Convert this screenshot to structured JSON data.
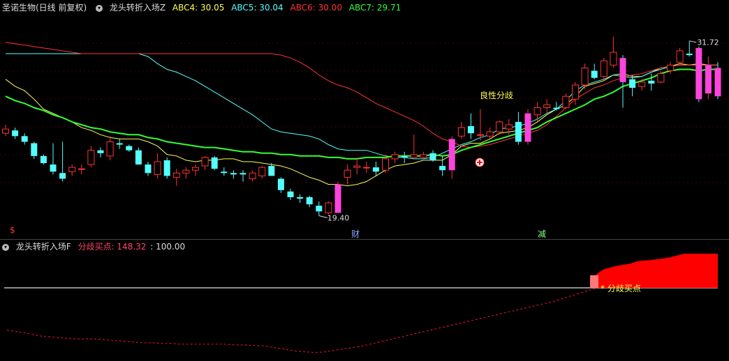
{
  "header": {
    "stock": "圣诺生物(日线 前复权)",
    "indicator": "龙头转折入场Z",
    "abc4": "ABC4: 30.05",
    "abc5": "ABC5: 30.04",
    "abc6": "ABC6: 30.00",
    "abc7": "ABC7: 29.71",
    "colors": {
      "abc4": "#ffff55",
      "abc5": "#55ffff",
      "abc6": "#ff3333",
      "abc7": "#33ff33"
    }
  },
  "lower_header": {
    "indicator": "龙头转折入场F",
    "label": "分歧买点: 148.32",
    "value": ": 100.00"
  },
  "annotations": {
    "low_price": "19.40",
    "high_price": "31.72",
    "label_good": "良性分歧",
    "mark_cai": "财",
    "mark_jian": "减",
    "mark_dollar": "$",
    "buy_label": "分歧买点"
  },
  "chart_data": [
    {
      "type": "candlestick",
      "title": "圣诺生物(日线 前复权)",
      "ylim": [
        18,
        33.5
      ],
      "candles": [
        [
          25.2,
          25.8,
          25.0,
          25.5
        ],
        [
          25.4,
          25.6,
          24.8,
          25.0
        ],
        [
          25.0,
          25.2,
          24.4,
          24.6
        ],
        [
          24.5,
          24.6,
          23.4,
          23.6
        ],
        [
          23.6,
          23.7,
          23.0,
          23.1
        ],
        [
          23.0,
          24.5,
          22.3,
          22.5
        ],
        [
          22.4,
          24.6,
          21.8,
          22.0
        ],
        [
          22.5,
          23.0,
          22.2,
          22.8
        ],
        [
          22.7,
          23.0,
          22.3,
          22.7
        ],
        [
          23.0,
          24.3,
          22.8,
          24.0
        ],
        [
          24.0,
          24.2,
          23.5,
          23.8
        ],
        [
          23.6,
          25.0,
          23.3,
          24.6
        ],
        [
          24.5,
          24.8,
          24.1,
          24.4
        ],
        [
          24.3,
          24.4,
          23.9,
          24.0
        ],
        [
          24.0,
          24.2,
          23.0,
          23.0
        ],
        [
          23.0,
          23.2,
          22.2,
          22.4
        ],
        [
          22.3,
          23.8,
          22.0,
          23.2
        ],
        [
          23.3,
          23.5,
          22.0,
          22.2
        ],
        [
          22.1,
          22.7,
          21.5,
          22.4
        ],
        [
          22.4,
          22.8,
          22.0,
          22.6
        ],
        [
          22.6,
          23.0,
          22.2,
          22.8
        ],
        [
          22.9,
          23.6,
          22.6,
          23.5
        ],
        [
          23.5,
          23.6,
          22.6,
          22.7
        ],
        [
          22.5,
          22.8,
          22.2,
          22.4
        ],
        [
          22.4,
          22.6,
          22.0,
          22.3
        ],
        [
          22.4,
          22.6,
          21.8,
          22.3
        ],
        [
          22.0,
          22.6,
          21.8,
          22.4
        ],
        [
          22.2,
          22.9,
          22.0,
          22.8
        ],
        [
          22.9,
          23.1,
          22.2,
          22.2
        ],
        [
          22.0,
          22.1,
          21.0,
          21.2
        ],
        [
          21.1,
          21.3,
          20.5,
          20.7
        ],
        [
          20.7,
          20.9,
          20.3,
          20.6
        ],
        [
          20.7,
          20.8,
          20.0,
          20.2
        ],
        [
          20.1,
          20.4,
          19.4,
          19.7
        ],
        [
          19.6,
          20.4,
          19.5,
          20.3
        ],
        [
          19.6,
          21.8,
          19.6,
          21.6
        ],
        [
          22.1,
          23.0,
          21.6,
          22.6
        ],
        [
          22.8,
          23.5,
          22.3,
          22.9
        ],
        [
          22.8,
          23.2,
          22.4,
          22.8
        ],
        [
          22.8,
          23.2,
          22.2,
          22.5
        ],
        [
          22.6,
          23.7,
          22.4,
          23.4
        ],
        [
          23.4,
          23.9,
          23.1,
          23.7
        ],
        [
          23.6,
          23.9,
          23.1,
          23.5
        ],
        [
          23.5,
          25.1,
          23.4,
          23.7
        ],
        [
          23.5,
          23.9,
          23.4,
          23.7
        ],
        [
          23.8,
          24.0,
          23.2,
          23.3
        ],
        [
          22.9,
          23.6,
          22.2,
          22.6
        ],
        [
          22.6,
          25.0,
          22.0,
          24.8
        ],
        [
          25.0,
          26.0,
          24.8,
          25.6
        ],
        [
          25.7,
          26.6,
          24.8,
          25.2
        ],
        [
          25.1,
          26.9,
          24.7,
          25.1
        ],
        [
          25.0,
          25.6,
          24.8,
          25.3
        ],
        [
          25.3,
          26.1,
          25.1,
          26.0
        ],
        [
          25.5,
          26.2,
          25.1,
          25.8
        ],
        [
          26.0,
          26.7,
          24.4,
          24.6
        ],
        [
          24.6,
          26.9,
          24.4,
          26.6
        ],
        [
          26.5,
          27.4,
          26.0,
          27.0
        ],
        [
          27.0,
          27.6,
          26.6,
          27.2
        ],
        [
          27.0,
          27.4,
          26.8,
          26.9
        ],
        [
          27.0,
          28.0,
          26.9,
          27.8
        ],
        [
          27.6,
          28.8,
          27.2,
          28.6
        ],
        [
          28.6,
          30.1,
          28.3,
          29.8
        ],
        [
          29.6,
          30.1,
          29.0,
          29.1
        ],
        [
          29.2,
          30.5,
          28.9,
          30.3
        ],
        [
          30.0,
          32.0,
          29.8,
          30.9
        ],
        [
          30.5,
          30.7,
          27.0,
          28.8
        ],
        [
          29.0,
          29.3,
          27.8,
          28.4
        ],
        [
          28.5,
          29.0,
          28.2,
          28.8
        ],
        [
          28.9,
          29.4,
          28.2,
          28.7
        ],
        [
          28.8,
          29.6,
          28.7,
          29.4
        ],
        [
          29.6,
          30.2,
          29.4,
          30.0
        ],
        [
          30.2,
          31.2,
          30.0,
          31.0
        ],
        [
          30.8,
          31.7,
          30.6,
          30.7
        ],
        [
          31.2,
          31.3,
          27.4,
          27.6
        ],
        [
          28.0,
          30.6,
          27.6,
          30.0
        ],
        [
          29.8,
          30.2,
          27.6,
          27.8
        ]
      ],
      "series": [
        {
          "name": "ABC4",
          "values": [
            29,
            28.5,
            28.2,
            27.6,
            26.9,
            26.6,
            26.3,
            26,
            25.6,
            25.4,
            25.1,
            24.9,
            24.8,
            24.8,
            24.8,
            24.6,
            24.3,
            23.7,
            23.6,
            23.3,
            23.2,
            23.3,
            23.3,
            23.4,
            23.4,
            23.2,
            23.2,
            23.1,
            23,
            22.9,
            22.7,
            22.4,
            22.1,
            21.9,
            21.6,
            21.6,
            21.5,
            21.6,
            21.8,
            22.2,
            22.6,
            22.9,
            23,
            23.1,
            23.3,
            23.3,
            23.3,
            23.7,
            24.3,
            24.5,
            24.5,
            24.8,
            25.2,
            25.3,
            25.4,
            25.6,
            26,
            26.5,
            26.9,
            27.2,
            27.8,
            28.5,
            28.7,
            28.9,
            29.3,
            29.4,
            29.2,
            29.2,
            29.5,
            29.8,
            29.9,
            30.1,
            30,
            30.1,
            30,
            30
          ]
        },
        {
          "name": "ABC5",
          "values": [
            30.8,
            30.8,
            30.8,
            30.8,
            30.8,
            30.8,
            30.8,
            30.8,
            30.8,
            30.8,
            30.8,
            30.8,
            30.8,
            30.8,
            30.8,
            30.6,
            30.1,
            29.7,
            29.5,
            29.2,
            28.9,
            28.5,
            28.1,
            27.7,
            27.3,
            26.9,
            26.5,
            26,
            25.5,
            25.3,
            25.2,
            25.1,
            25,
            24.8,
            24.4,
            24.1,
            24,
            24,
            24,
            23.8,
            23.6,
            23.5,
            23.5,
            23.4,
            23.4,
            23.5,
            23.8,
            24.1,
            24.4,
            24.6,
            24.9,
            25.1,
            25.5,
            25.6,
            25.7,
            25.9,
            26.2,
            26.6,
            26.9,
            27.5,
            28.2,
            28.6,
            28.8,
            29,
            29.3,
            29.2,
            29.1,
            29.2,
            29.5,
            29.7,
            29.9,
            30,
            30,
            30,
            30,
            30
          ]
        },
        {
          "name": "ABC6",
          "values": [
            31.6,
            31.5,
            31.4,
            31.3,
            31.2,
            31.1,
            31,
            30.9,
            30.8,
            30.8,
            30.8,
            30.8,
            30.8,
            30.8,
            30.8,
            30.8,
            30.8,
            30.8,
            30.8,
            30.8,
            30.8,
            30.8,
            30.8,
            30.8,
            30.8,
            30.8,
            30.8,
            30.8,
            30.8,
            30.7,
            30.5,
            30.2,
            29.8,
            29.3,
            28.9,
            28.6,
            28.4,
            28.1,
            27.7,
            27.3,
            27,
            26.7,
            26.4,
            26.1,
            25.7,
            25.2,
            24.8,
            24.6,
            24.3,
            24.2,
            24.3,
            24.4,
            24.6,
            24.8,
            25,
            25.2,
            25.4,
            25.8,
            26.4,
            27,
            27.6,
            28,
            28.4,
            28.6,
            28.9,
            29.1,
            29.3,
            29.4,
            29.6,
            29.8,
            29.9,
            30,
            30,
            30,
            30,
            30
          ]
        },
        {
          "name": "ABC7",
          "values": [
            27.8,
            27.5,
            27.3,
            27,
            26.8,
            26.5,
            26.3,
            26,
            25.8,
            25.6,
            25.5,
            25.3,
            25.2,
            25.1,
            25.1,
            24.9,
            24.8,
            24.6,
            24.5,
            24.4,
            24.3,
            24.2,
            24.2,
            24.1,
            24,
            23.9,
            23.9,
            23.8,
            23.8,
            23.7,
            23.7,
            23.6,
            23.6,
            23.6,
            23.5,
            23.5,
            23.4,
            23.4,
            23.5,
            23.5,
            23.5,
            23.6,
            23.6,
            23.6,
            23.6,
            23.7,
            23.6,
            23.7,
            24,
            24.2,
            24.4,
            24.6,
            24.8,
            25,
            25.2,
            25.4,
            25.6,
            26,
            26.3,
            26.6,
            26.9,
            27.2,
            27.6,
            27.8,
            28.1,
            28.5,
            28.7,
            28.9,
            29.1,
            29.4,
            29.6,
            29.7,
            29.7,
            29.6,
            29.7,
            29.7
          ]
        }
      ]
    },
    {
      "type": "area",
      "title": "龙头转折入场F",
      "baseline": 100,
      "area_values": [
        0,
        0,
        0,
        0,
        0,
        0,
        0,
        0,
        0,
        0,
        0,
        0,
        0,
        0,
        0,
        0,
        0,
        0,
        0,
        0,
        0,
        0,
        0,
        0,
        0,
        0,
        0,
        0,
        0,
        0,
        0,
        0,
        0,
        0,
        0,
        0,
        0,
        0,
        0,
        0,
        0,
        0,
        0,
        0,
        0,
        0,
        0,
        0,
        0,
        0,
        0,
        0,
        0,
        0,
        0,
        0,
        0,
        0,
        0,
        0,
        0,
        0,
        0,
        0,
        0,
        0,
        0,
        0,
        30,
        60,
        80,
        88,
        95,
        100,
        105,
        115,
        118,
        120,
        124,
        128,
        133,
        140,
        148,
        148,
        148,
        148,
        148,
        148
      ],
      "line_values": [
        40,
        38,
        36,
        33,
        31,
        30,
        29,
        28,
        27,
        28,
        27,
        26,
        25,
        24,
        23,
        22,
        22,
        21,
        21,
        20,
        20,
        20,
        20,
        20,
        20,
        19,
        19,
        18,
        18,
        16,
        14,
        12,
        10,
        9,
        8,
        9,
        11,
        13,
        15,
        17,
        20,
        23,
        26,
        29,
        32,
        35,
        38,
        41,
        44,
        47,
        50,
        53,
        56,
        59,
        62,
        65,
        68,
        71,
        74,
        77,
        80,
        84,
        88,
        92,
        96,
        100
      ]
    }
  ]
}
